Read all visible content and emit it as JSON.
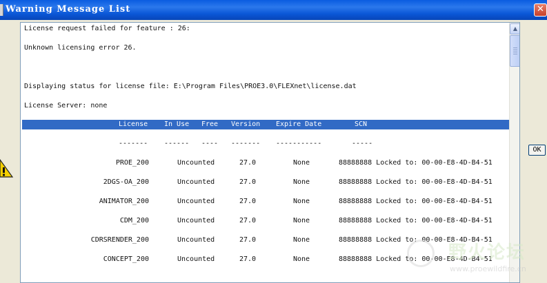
{
  "window": {
    "title": "Warning Message List",
    "ok_label": "OK"
  },
  "content": {
    "lines": [
      "License request failed for feature : 26:",
      "Unknown licensing error 26.",
      "Displaying status for license file: E:\\Program Files\\PROE3.0\\FLEXnet\\license.dat",
      "License Server: none"
    ]
  },
  "table": {
    "headers": [
      "License",
      "In Use",
      "Free",
      "Version",
      "Expire Date",
      "SCN"
    ],
    "dashes": [
      "-------",
      "------",
      "----",
      "-------",
      "-----------",
      "-----"
    ],
    "rows": [
      {
        "license": "PROE_200",
        "in_use": "Uncounted",
        "version": "27.0",
        "expire": "None",
        "scn": "88888888 Locked to: 00-00-E8-4D-B4-51"
      },
      {
        "license": "2DGS-OA_200",
        "in_use": "Uncounted",
        "version": "27.0",
        "expire": "None",
        "scn": "88888888 Locked to: 00-00-E8-4D-B4-51"
      },
      {
        "license": "ANIMATOR_200",
        "in_use": "Uncounted",
        "version": "27.0",
        "expire": "None",
        "scn": "88888888 Locked to: 00-00-E8-4D-B4-51"
      },
      {
        "license": "CDM_200",
        "in_use": "Uncounted",
        "version": "27.0",
        "expire": "None",
        "scn": "88888888 Locked to: 00-00-E8-4D-B4-51"
      },
      {
        "license": "CDRSRENDER_200",
        "in_use": "Uncounted",
        "version": "27.0",
        "expire": "None",
        "scn": "88888888 Locked to: 00-00-E8-4D-B4-51"
      },
      {
        "license": "CONCEPT_200",
        "in_use": "Uncounted",
        "version": "27.0",
        "expire": "None",
        "scn": "88888888 Locked to: 00-00-E8-4D-B4-51"
      }
    ]
  },
  "watermark": {
    "brand": "野火论坛",
    "url": "www.proewildfire.cn"
  },
  "colors": {
    "titlebar": "#0a5ce0",
    "header_selection": "#316ac5",
    "panel": "#ffffff",
    "frame": "#ece9d8"
  }
}
